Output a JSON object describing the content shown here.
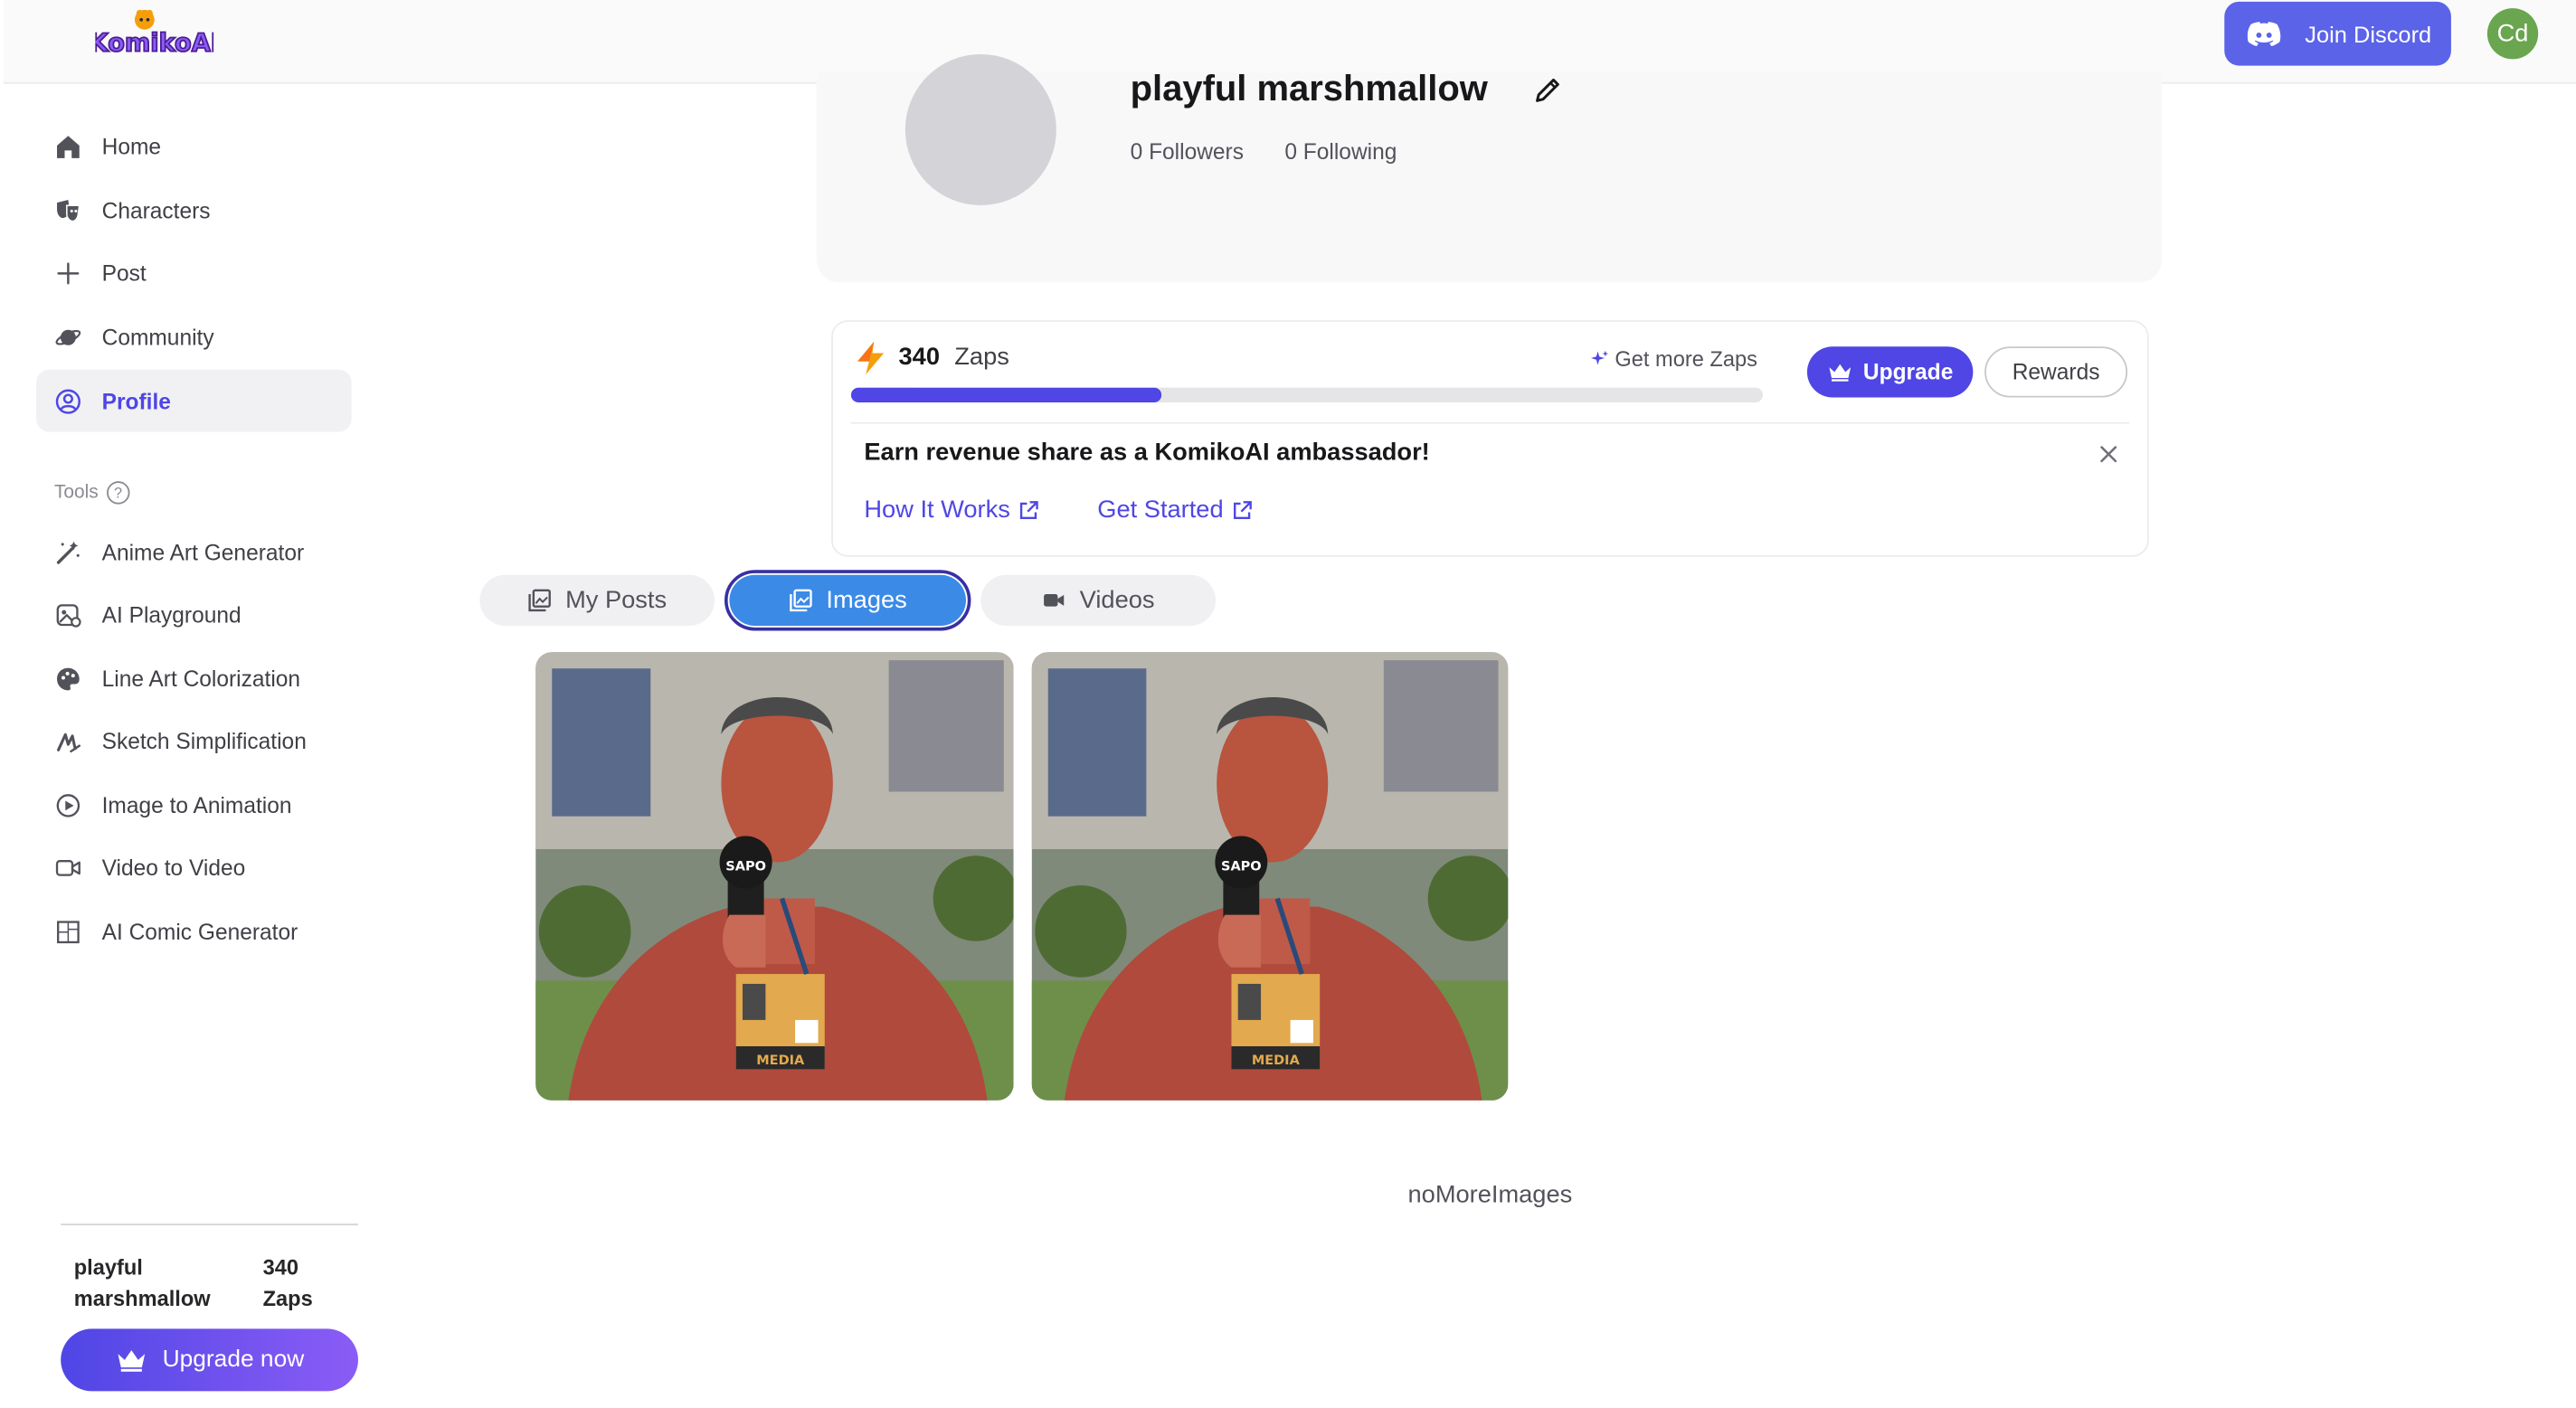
{
  "app": {
    "logo_text": "KomikoAI",
    "join_discord_label": "Join Discord",
    "user_initials": "Cd"
  },
  "sidebar": {
    "items": [
      {
        "label": "Home",
        "icon": "home-icon"
      },
      {
        "label": "Characters",
        "icon": "mask-icon"
      },
      {
        "label": "Post",
        "icon": "plus-icon"
      },
      {
        "label": "Community",
        "icon": "planet-icon"
      },
      {
        "label": "Profile",
        "icon": "user-circle-icon",
        "active": true
      }
    ],
    "tools_label": "Tools",
    "tools": [
      {
        "label": "Anime Art Generator",
        "icon": "magic-wand-icon"
      },
      {
        "label": "AI Playground",
        "icon": "playground-icon"
      },
      {
        "label": "Line Art Colorization",
        "icon": "palette-icon"
      },
      {
        "label": "Sketch Simplification",
        "icon": "sketch-icon"
      },
      {
        "label": "Image to Animation",
        "icon": "play-circle-icon"
      },
      {
        "label": "Video to Video",
        "icon": "video-camera-icon"
      },
      {
        "label": "AI Comic Generator",
        "icon": "comic-grid-icon"
      }
    ],
    "user_name": "playful marshmallow",
    "zaps_text": "340 Zaps",
    "upgrade_now_label": "Upgrade now"
  },
  "profile": {
    "name": "playful marshmallow",
    "followers_label": "0 Followers",
    "following_label": "0 Following"
  },
  "zaps": {
    "count": "340",
    "unit": "Zaps",
    "progress_fraction": 0.34,
    "get_more_label": "Get more Zaps",
    "upgrade_label": "Upgrade",
    "rewards_label": "Rewards",
    "ambassador_text": "Earn revenue share as a KomikoAI ambassador!",
    "how_it_works_label": "How It Works",
    "get_started_label": "Get Started"
  },
  "tabs": [
    {
      "label": "My Posts",
      "icon": "posts-icon"
    },
    {
      "label": "Images",
      "icon": "images-icon",
      "active": true
    },
    {
      "label": "Videos",
      "icon": "video-icon"
    }
  ],
  "gallery": {
    "media_badge": "MEDIA",
    "mic_brand": "SAPO",
    "end_text": "noMoreImages"
  },
  "colors": {
    "accent": "#4f46e5",
    "tab_active": "#3b8ae6",
    "discord": "#5b63e8",
    "avatar": "#6aa54f"
  }
}
